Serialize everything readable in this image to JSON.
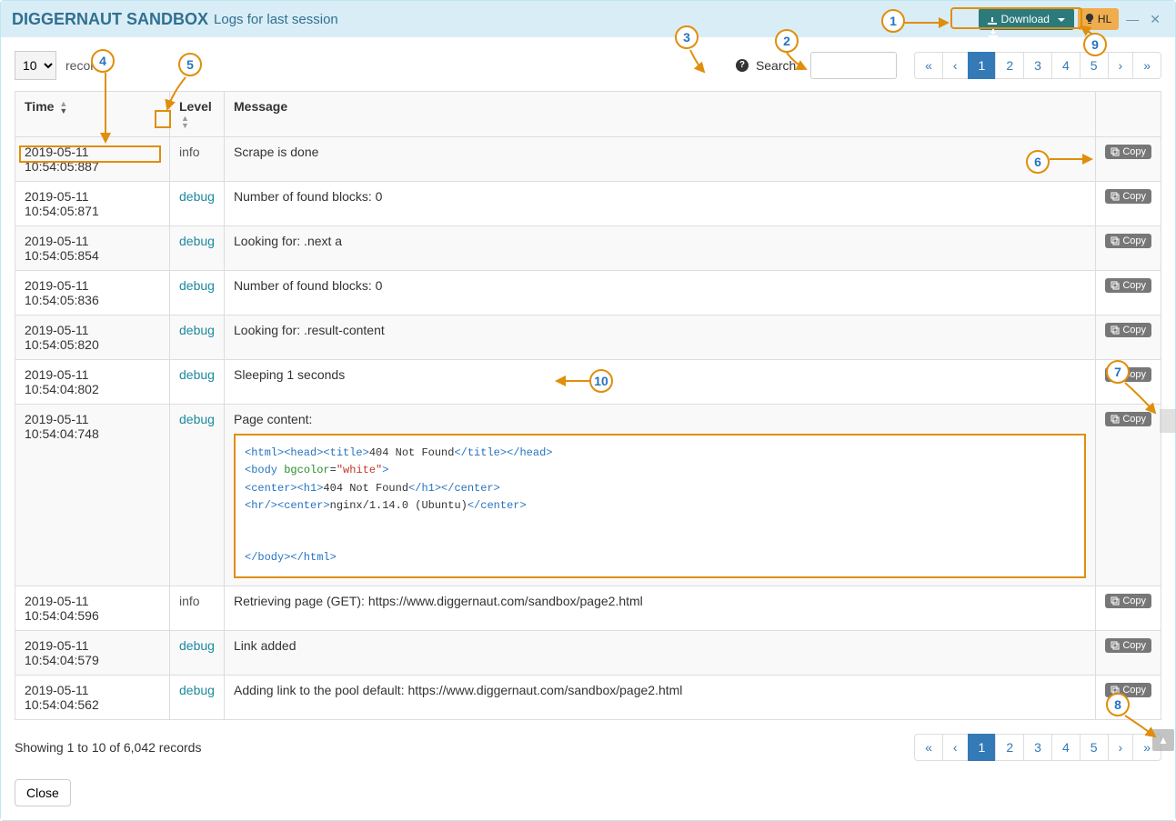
{
  "header": {
    "title": "DIGGERNAUT SANDBOX",
    "subtitle": "Logs for last session",
    "download_label": "Download",
    "hl_label": "HL",
    "minimize": "—",
    "close": "✕"
  },
  "toolbar": {
    "records_value": "10",
    "records_label": "records",
    "search_label": "Search :",
    "search_value": ""
  },
  "pagination": {
    "first": "«",
    "prev": "‹",
    "pages": [
      "1",
      "2",
      "3",
      "4",
      "5"
    ],
    "next": "›",
    "last": "»",
    "active": "1"
  },
  "columns": {
    "time": "Time",
    "level": "Level",
    "message": "Message"
  },
  "copy_label": "Copy",
  "rows": [
    {
      "time": "2019-05-11 10:54:05:887",
      "level": "info",
      "message": "Scrape is done"
    },
    {
      "time": "2019-05-11 10:54:05:871",
      "level": "debug",
      "message": "Number of found blocks: 0"
    },
    {
      "time": "2019-05-11 10:54:05:854",
      "level": "debug",
      "message": "Looking for: .next a"
    },
    {
      "time": "2019-05-11 10:54:05:836",
      "level": "debug",
      "message": "Number of found blocks: 0"
    },
    {
      "time": "2019-05-11 10:54:05:820",
      "level": "debug",
      "message": "Looking for: .result-content"
    },
    {
      "time": "2019-05-11 10:54:04:802",
      "level": "debug",
      "message": "Sleeping 1 seconds"
    },
    {
      "time": "2019-05-11 10:54:04:748",
      "level": "debug",
      "message": "Page content:"
    },
    {
      "time": "2019-05-11 10:54:04:596",
      "level": "info",
      "message": "Retrieving page (GET): https://www.diggernaut.com/sandbox/page2.html"
    },
    {
      "time": "2019-05-11 10:54:04:579",
      "level": "debug",
      "message": "Link added"
    },
    {
      "time": "2019-05-11 10:54:04:562",
      "level": "debug",
      "message": "Adding link to the pool default: https://www.diggernaut.com/sandbox/page2.html"
    }
  ],
  "code_block": {
    "line1_pre": "<html><head><title>",
    "line1_txt": "404 Not Found",
    "line1_post": "</title></head>",
    "line2_a": "<body ",
    "line2_attr": "bgcolor",
    "line2_eq": "=",
    "line2_val": "\"white\"",
    "line2_b": ">",
    "line3_a": "<center><h1>",
    "line3_txt": "404 Not Found",
    "line3_b": "</h1></center>",
    "line4_a": "<hr/><center>",
    "line4_txt": "nginx/1.14.0 (Ubuntu)",
    "line4_b": "</center>",
    "line5": "",
    "line6": "",
    "line7": "</body></html>"
  },
  "footer": {
    "showing": "Showing 1 to 10 of 6,042 records",
    "close_label": "Close"
  },
  "annotations": {
    "a1": "1",
    "a2": "2",
    "a3": "3",
    "a4": "4",
    "a5": "5",
    "a6": "6",
    "a7": "7",
    "a8": "8",
    "a9": "9",
    "a10": "10"
  }
}
